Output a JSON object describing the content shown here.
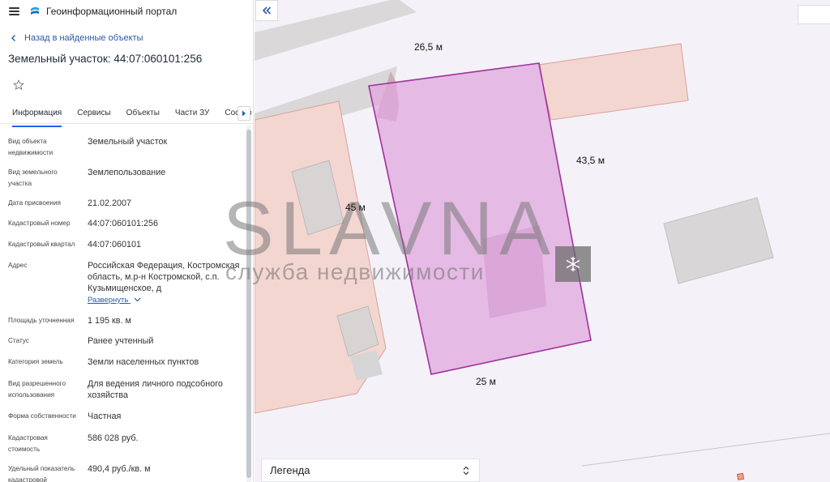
{
  "app": {
    "title": "Геоинформационный портал"
  },
  "nav": {
    "back_label": "Назад в найденные объекты"
  },
  "object": {
    "title": "Земельный участок: 44:07:060101:256"
  },
  "tabs": [
    {
      "label": "Информация",
      "active": true
    },
    {
      "label": "Сервисы"
    },
    {
      "label": "Объекты"
    },
    {
      "label": "Части ЗУ"
    },
    {
      "label": "Состав"
    }
  ],
  "props": [
    {
      "key": "Вид объекта недвижимости",
      "value": "Земельный участок"
    },
    {
      "key": "Вид земельного участка",
      "value": "Землепользование"
    },
    {
      "key": "Дата присвоения",
      "value": "21.02.2007"
    },
    {
      "key": "Кадастровый номер",
      "value": "44:07:060101:256"
    },
    {
      "key": "Кадастровый квартал",
      "value": "44:07:060101"
    },
    {
      "key": "Адрес",
      "value": "Российская Федерация, Костромская область, м.р-н Костромской, с.п. Кузьмищенское, д"
    },
    {
      "key": "Площадь уточненная",
      "value": "1 195 кв. м"
    },
    {
      "key": "Статус",
      "value": "Ранее учтенный"
    },
    {
      "key": "Категория земель",
      "value": "Земли населенных пунктов"
    },
    {
      "key": "Вид разрешенного использования",
      "value": "Для ведения личного подсобного хозяйства"
    },
    {
      "key": "Форма собственности",
      "value": "Частная"
    },
    {
      "key": "Кадастровая стоимость",
      "value": "586 028 руб."
    },
    {
      "key": "Удельный показатель кадастровой",
      "value": "490,4 руб./кв. м"
    }
  ],
  "expand_label": "Развернуть",
  "map": {
    "dims": {
      "top": "26,5 м",
      "right": "43,5 м",
      "left": "45 м",
      "bottom": "25 м"
    },
    "watermark": {
      "main": "SLAVNA",
      "sub": "служба недвижимости"
    },
    "legend_label": "Легенда"
  },
  "colors": {
    "accent": "#2563eb",
    "link": "#2b5aa8",
    "parcel_fill": "#e0a7de",
    "parcel_stroke": "#a0309d"
  }
}
